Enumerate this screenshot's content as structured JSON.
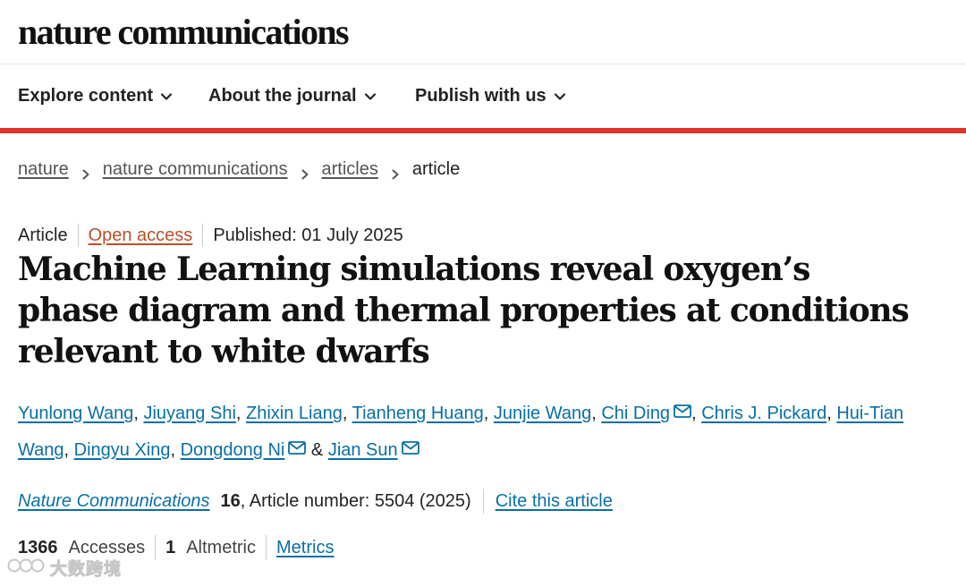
{
  "site": {
    "logo": "nature communications"
  },
  "nav": {
    "items": [
      {
        "label": "Explore content"
      },
      {
        "label": "About the journal"
      },
      {
        "label": "Publish with us"
      }
    ]
  },
  "colors": {
    "accent": "#e0342a",
    "link": "#0a6fa5",
    "open_access": "#b6502a"
  },
  "breadcrumb": {
    "items": [
      "nature",
      "nature communications",
      "articles"
    ],
    "current": "article"
  },
  "article": {
    "type": "Article",
    "access": "Open access",
    "published": "Published: 01 July 2025",
    "title": "Machine Learning simulations reveal oxygen’s phase diagram and thermal properties at conditions relevant to white dwarfs",
    "authors": [
      "Yunlong Wang",
      "Jiuyang Shi",
      "Zhixin Liang",
      "Tianheng Huang",
      "Junjie Wang",
      "Chi Ding",
      "Chris J. Pickard",
      "Hui-Tian Wang",
      "Dingyu Xing",
      "Dongdong Ni",
      "Jian Sun"
    ],
    "author_sep": ", ",
    "author_last_sep": " & ",
    "citation": {
      "journal": "Nature Communications",
      "volume": "16",
      "article_number": ", Article number: 5504 (2025)",
      "cite_link": "Cite this article"
    },
    "metrics": {
      "accesses_value": "1366",
      "accesses_label": "Accesses",
      "altmetric_value": "1",
      "altmetric_label": "Altmetric",
      "metrics_link": "Metrics"
    }
  },
  "icons": {
    "chevron": "chevron-down-icon",
    "breadcrumb_sep": "chevron-right-icon",
    "mail": "mail-icon"
  },
  "watermark": {
    "text": "大数跨境"
  }
}
